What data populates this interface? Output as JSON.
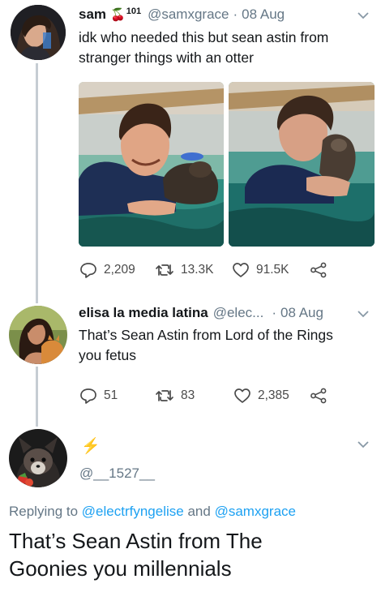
{
  "tweet1": {
    "name": "sam",
    "badge_emoji": "🍒",
    "badge_number": "101",
    "handle": "@samxgrace",
    "separator": "·",
    "date": "08 Aug",
    "text_line1": "idk who needed this but sean astin from",
    "text_line2": "stranger things with an otter",
    "replies": "2,209",
    "retweets": "13.3K",
    "likes": "91.5K"
  },
  "tweet2": {
    "name": "elisa la media latina",
    "handle": "@elec...",
    "separator": "·",
    "date": "08 Aug",
    "text_line1": "That’s Sean Astin from Lord of the Rings",
    "text_line2": "you fetus",
    "replies": "51",
    "retweets": "83",
    "likes": "2,385"
  },
  "tweet3": {
    "name_emoji": "⚡",
    "handle": "@__1527__",
    "replying_prefix": "Replying to",
    "replying_user1": "@electrfyngelise",
    "replying_and": "and",
    "replying_user2": "@samxgrace",
    "text_line1": "That’s Sean Astin from The",
    "text_line2": "Goonies you millennials"
  },
  "colors": {
    "link": "#1da1f2",
    "muted": "#657786",
    "lightning": "#f5b800"
  }
}
